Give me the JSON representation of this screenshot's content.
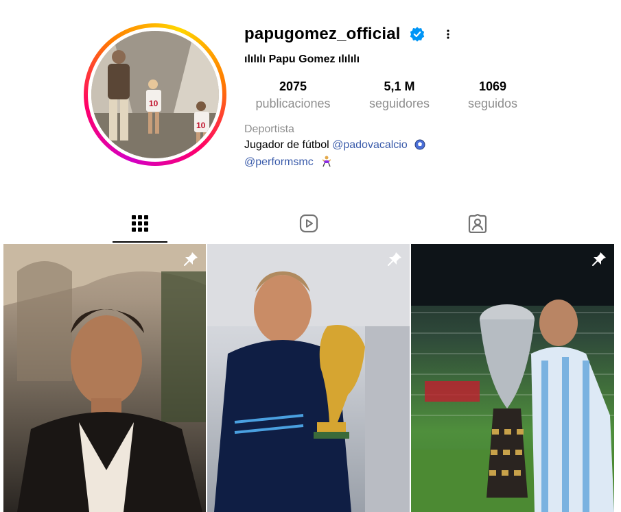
{
  "profile": {
    "username": "papugomez_official",
    "display_name": "ılılılı Papu Gomez ılılılı",
    "category": "Deportista",
    "bio_line1": "Jugador de fútbol",
    "bio_mention1": "@padovacalcio",
    "bio_mention2": "@performsmc",
    "verified": true
  },
  "stats": [
    {
      "value": "2075",
      "label": "publicaciones"
    },
    {
      "value": "5,1 M",
      "label": "seguidores"
    },
    {
      "value": "1069",
      "label": "seguidos"
    }
  ],
  "tabs": [
    {
      "icon": "grid-icon",
      "active": true
    },
    {
      "icon": "reels-icon",
      "active": false
    },
    {
      "icon": "tagged-icon",
      "active": false
    }
  ],
  "posts": [
    {
      "pinned": true,
      "icon": "pin-icon"
    },
    {
      "pinned": true,
      "icon": "pin-icon"
    },
    {
      "pinned": true,
      "icon": "pin-icon"
    }
  ],
  "colors": {
    "link": "#3a5baa",
    "muted": "#8e8e8e",
    "verified": "#0095f6"
  }
}
